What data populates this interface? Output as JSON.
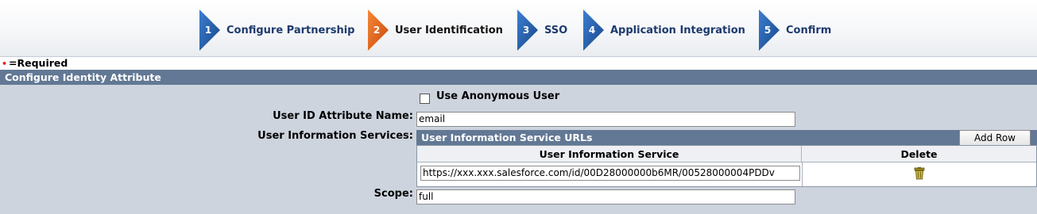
{
  "wizard": {
    "steps": [
      {
        "number": "1",
        "label": "Configure Partnership",
        "state": "inactive"
      },
      {
        "number": "2",
        "label": "User Identification",
        "state": "active"
      },
      {
        "number": "3",
        "label": "SSO",
        "state": "inactive"
      },
      {
        "number": "4",
        "label": "Application Integration",
        "state": "inactive"
      },
      {
        "number": "5",
        "label": "Confirm",
        "state": "inactive"
      }
    ],
    "colors": {
      "inactive": "#1f5aa6",
      "active": "#e8641a"
    }
  },
  "required_note": {
    "marker": "•",
    "text": "=Required"
  },
  "section": {
    "title": "Configure Identity Attribute",
    "anonymous_user": {
      "label": "Use Anonymous User",
      "checked": false
    },
    "user_id_attribute": {
      "label": "User ID Attribute Name:",
      "value": "email"
    },
    "user_info_services": {
      "label": "User Information Services:",
      "table_title": "User Information Service URLs",
      "add_row_label": "Add Row",
      "columns": [
        "User Information Service",
        "Delete"
      ],
      "rows": [
        {
          "url": "https://xxx.xxx.salesforce.com/id/00D28000000b6MR/00528000004PDDv",
          "delete_icon": "trash-icon"
        }
      ]
    },
    "scope": {
      "label": "Scope:",
      "value": "full"
    }
  }
}
